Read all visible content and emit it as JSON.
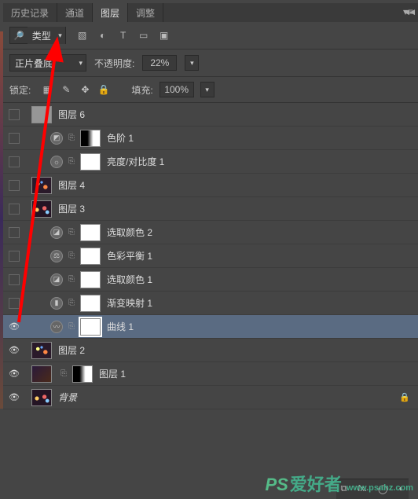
{
  "tabs": {
    "history": "历史记录",
    "channels": "通道",
    "layers": "图层",
    "adjustments": "调整"
  },
  "filter": {
    "kind": "类型"
  },
  "blend": {
    "mode": "正片叠底",
    "opacity_label": "不透明度:",
    "opacity_value": "22%"
  },
  "lock": {
    "label": "锁定:",
    "fill_label": "填充:",
    "fill_value": "100%"
  },
  "layers": [
    {
      "name": "图层 6"
    },
    {
      "name": "色阶 1"
    },
    {
      "name": "亮度/对比度 1"
    },
    {
      "name": "图层 4"
    },
    {
      "name": "图层 3"
    },
    {
      "name": "选取颜色 2"
    },
    {
      "name": "色彩平衡 1"
    },
    {
      "name": "选取颜色 1"
    },
    {
      "name": "渐变映射 1"
    },
    {
      "name": "曲线 1"
    },
    {
      "name": "图层 2"
    },
    {
      "name": "图层 1"
    },
    {
      "name": "背景"
    }
  ],
  "watermark": {
    "ps": "PS",
    "zh": "爱好者",
    "url": "www.psahz.com"
  }
}
